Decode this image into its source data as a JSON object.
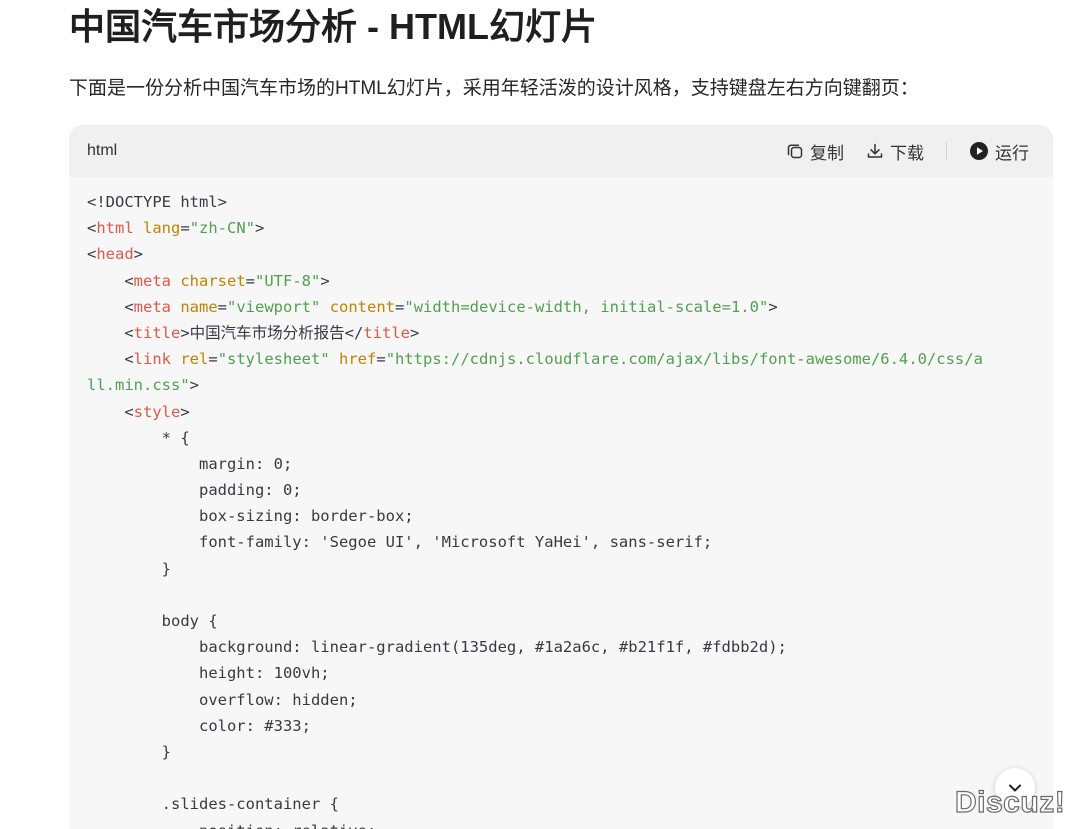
{
  "page": {
    "title": "中国汽车市场分析 - HTML幻灯片",
    "intro": "下面是一份分析中国汽车市场的HTML幻灯片，采用年轻活泼的设计风格，支持键盘左右方向键翻页："
  },
  "code_block": {
    "language": "html",
    "actions": {
      "copy": "复制",
      "download": "下载",
      "run": "运行"
    },
    "lines": [
      [
        [
          "p",
          "<!DOCTYPE html>"
        ]
      ],
      [
        [
          "p",
          "<"
        ],
        [
          "t",
          "html"
        ],
        [
          "p",
          " "
        ],
        [
          "a",
          "lang"
        ],
        [
          "p",
          "="
        ],
        [
          "s",
          "\"zh-CN\""
        ],
        [
          "p",
          ">"
        ]
      ],
      [
        [
          "p",
          "<"
        ],
        [
          "t",
          "head"
        ],
        [
          "p",
          ">"
        ]
      ],
      [
        [
          "p",
          "    <"
        ],
        [
          "t",
          "meta"
        ],
        [
          "p",
          " "
        ],
        [
          "a",
          "charset"
        ],
        [
          "p",
          "="
        ],
        [
          "s",
          "\"UTF-8\""
        ],
        [
          "p",
          ">"
        ]
      ],
      [
        [
          "p",
          "    <"
        ],
        [
          "t",
          "meta"
        ],
        [
          "p",
          " "
        ],
        [
          "a",
          "name"
        ],
        [
          "p",
          "="
        ],
        [
          "s",
          "\"viewport\""
        ],
        [
          "p",
          " "
        ],
        [
          "a",
          "content"
        ],
        [
          "p",
          "="
        ],
        [
          "s",
          "\"width=device-width, initial-scale=1.0\""
        ],
        [
          "p",
          ">"
        ]
      ],
      [
        [
          "p",
          "    <"
        ],
        [
          "t",
          "title"
        ],
        [
          "p",
          ">中国汽车市场分析报告</"
        ],
        [
          "t",
          "title"
        ],
        [
          "p",
          ">"
        ]
      ],
      [
        [
          "p",
          "    <"
        ],
        [
          "t",
          "link"
        ],
        [
          "p",
          " "
        ],
        [
          "a",
          "rel"
        ],
        [
          "p",
          "="
        ],
        [
          "s",
          "\"stylesheet\""
        ],
        [
          "p",
          " "
        ],
        [
          "a",
          "href"
        ],
        [
          "p",
          "="
        ],
        [
          "s",
          "\"https://cdnjs.cloudflare.com/ajax/libs/font-awesome/6.4.0/css/a"
        ]
      ],
      [
        [
          "s",
          "ll.min.css\""
        ],
        [
          "p",
          ">"
        ]
      ],
      [
        [
          "p",
          "    <"
        ],
        [
          "t",
          "style"
        ],
        [
          "p",
          ">"
        ]
      ],
      [
        [
          "p",
          "        * {"
        ]
      ],
      [
        [
          "p",
          "            margin: 0;"
        ]
      ],
      [
        [
          "p",
          "            padding: 0;"
        ]
      ],
      [
        [
          "p",
          "            box-sizing: border-box;"
        ]
      ],
      [
        [
          "p",
          "            font-family: 'Segoe UI', 'Microsoft YaHei', sans-serif;"
        ]
      ],
      [
        [
          "p",
          "        }"
        ]
      ],
      [
        [
          "p",
          ""
        ]
      ],
      [
        [
          "p",
          "        body {"
        ]
      ],
      [
        [
          "p",
          "            background: linear-gradient(135deg, #1a2a6c, #b21f1f, #fdbb2d);"
        ]
      ],
      [
        [
          "p",
          "            height: 100vh;"
        ]
      ],
      [
        [
          "p",
          "            overflow: hidden;"
        ]
      ],
      [
        [
          "p",
          "            color: #333;"
        ]
      ],
      [
        [
          "p",
          "        }"
        ]
      ],
      [
        [
          "p",
          ""
        ]
      ],
      [
        [
          "p",
          "        .slides-container {"
        ]
      ],
      [
        [
          "p",
          "            position: relative;"
        ]
      ]
    ]
  },
  "watermark": "Discuz!",
  "icons": {
    "copy": "copy-icon",
    "download": "download-icon",
    "run": "play-circle-icon",
    "scroll": "chevron-down-icon"
  },
  "colors": {
    "tag": "#e45649",
    "attr": "#c18401",
    "string": "#50a14f",
    "plain": "#383a42"
  }
}
